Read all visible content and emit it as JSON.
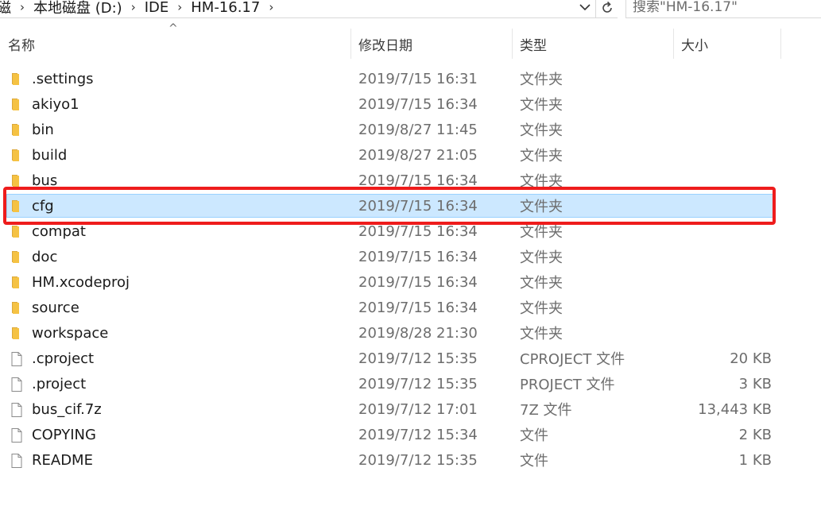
{
  "address_bar": {
    "crumbs": [
      "磁",
      "本地磁盘 (D:)",
      "IDE",
      "HM-16.17"
    ],
    "separator": "›"
  },
  "search": {
    "placeholder": "搜索\"HM-16.17\""
  },
  "columns": {
    "name": "名称",
    "date": "修改日期",
    "type": "类型",
    "size": "大小"
  },
  "sort_indicator": "^",
  "files": [
    {
      "name": ".settings",
      "date": "2019/7/15 16:31",
      "type": "文件夹",
      "size": "",
      "icon": "folder-icon"
    },
    {
      "name": "akiyo1",
      "date": "2019/7/15 16:34",
      "type": "文件夹",
      "size": "",
      "icon": "folder-icon"
    },
    {
      "name": "bin",
      "date": "2019/8/27 11:45",
      "type": "文件夹",
      "size": "",
      "icon": "folder-icon"
    },
    {
      "name": "build",
      "date": "2019/8/27 21:05",
      "type": "文件夹",
      "size": "",
      "icon": "folder-icon"
    },
    {
      "name": "bus",
      "date": "2019/7/15 16:34",
      "type": "文件夹",
      "size": "",
      "icon": "folder-icon"
    },
    {
      "name": "cfg",
      "date": "2019/7/15 16:34",
      "type": "文件夹",
      "size": "",
      "icon": "folder-icon",
      "selected": true
    },
    {
      "name": "compat",
      "date": "2019/7/15 16:34",
      "type": "文件夹",
      "size": "",
      "icon": "folder-icon"
    },
    {
      "name": "doc",
      "date": "2019/7/15 16:34",
      "type": "文件夹",
      "size": "",
      "icon": "folder-icon"
    },
    {
      "name": "HM.xcodeproj",
      "date": "2019/7/15 16:34",
      "type": "文件夹",
      "size": "",
      "icon": "folder-icon"
    },
    {
      "name": "source",
      "date": "2019/7/15 16:34",
      "type": "文件夹",
      "size": "",
      "icon": "folder-icon"
    },
    {
      "name": "workspace",
      "date": "2019/8/28 21:30",
      "type": "文件夹",
      "size": "",
      "icon": "folder-icon"
    },
    {
      "name": ".cproject",
      "date": "2019/7/12 15:35",
      "type": "CPROJECT 文件",
      "size": "20 KB",
      "icon": "file-icon"
    },
    {
      "name": ".project",
      "date": "2019/7/12 15:35",
      "type": "PROJECT 文件",
      "size": "3 KB",
      "icon": "file-icon"
    },
    {
      "name": "bus_cif.7z",
      "date": "2019/7/12 17:01",
      "type": "7Z 文件",
      "size": "13,443 KB",
      "icon": "file-icon"
    },
    {
      "name": "COPYING",
      "date": "2019/7/12 15:34",
      "type": "文件",
      "size": "2 KB",
      "icon": "file-icon"
    },
    {
      "name": "README",
      "date": "2019/7/12 15:35",
      "type": "文件",
      "size": "1 KB",
      "icon": "file-icon"
    }
  ],
  "colors": {
    "selection_bg": "#cce8ff",
    "highlight_border": "#ee1c1c",
    "folder": "#f5c243"
  }
}
